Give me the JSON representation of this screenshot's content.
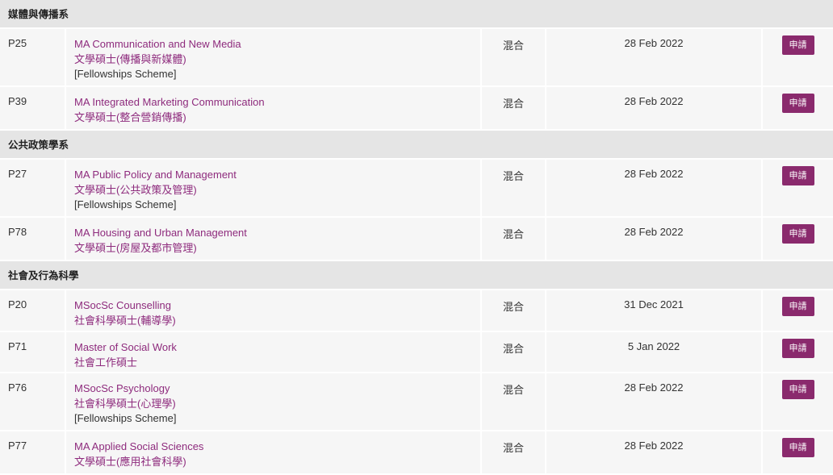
{
  "apply_label": "申請",
  "sections": [
    {
      "dept": "媒體與傳播系",
      "rows": [
        {
          "code": "P25",
          "en": "MA Communication and New Media",
          "zh": "文學碩士(傳播與新媒體)",
          "note": "[Fellowships Scheme]",
          "mode": "混合",
          "deadline": "28 Feb 2022"
        },
        {
          "code": "P39",
          "en": "MA Integrated Marketing Communication",
          "zh": "文學碩士(整合營銷傳播)",
          "note": "",
          "mode": "混合",
          "deadline": "28 Feb 2022"
        }
      ]
    },
    {
      "dept": "公共政策學系",
      "rows": [
        {
          "code": "P27",
          "en": "MA Public Policy and Management",
          "zh": "文學碩士(公共政策及管理)",
          "note": "[Fellowships Scheme]",
          "mode": "混合",
          "deadline": "28 Feb 2022"
        },
        {
          "code": "P78",
          "en": "MA Housing and Urban Management",
          "zh": "文學碩士(房屋及都市管理)",
          "note": "",
          "mode": "混合",
          "deadline": "28 Feb 2022"
        }
      ]
    },
    {
      "dept": "社會及行為科學",
      "rows": [
        {
          "code": "P20",
          "en": "MSocSc Counselling",
          "zh": "社會科學碩士(輔導學)",
          "note": "",
          "mode": "混合",
          "deadline": "31 Dec 2021"
        },
        {
          "code": "P71",
          "en": "Master of Social Work",
          "zh": "社會工作碩士",
          "note": "",
          "mode": "混合",
          "deadline": "5 Jan 2022"
        },
        {
          "code": "P76",
          "en": "MSocSc Psychology",
          "zh": "社會科學碩士(心理學)",
          "note": "[Fellowships Scheme]",
          "mode": "混合",
          "deadline": "28 Feb 2022"
        },
        {
          "code": "P77",
          "en": "MA Applied Social Sciences",
          "zh": "文學碩士(應用社會科學)",
          "note": "",
          "mode": "混合",
          "deadline": "28 Feb 2022"
        }
      ]
    }
  ]
}
